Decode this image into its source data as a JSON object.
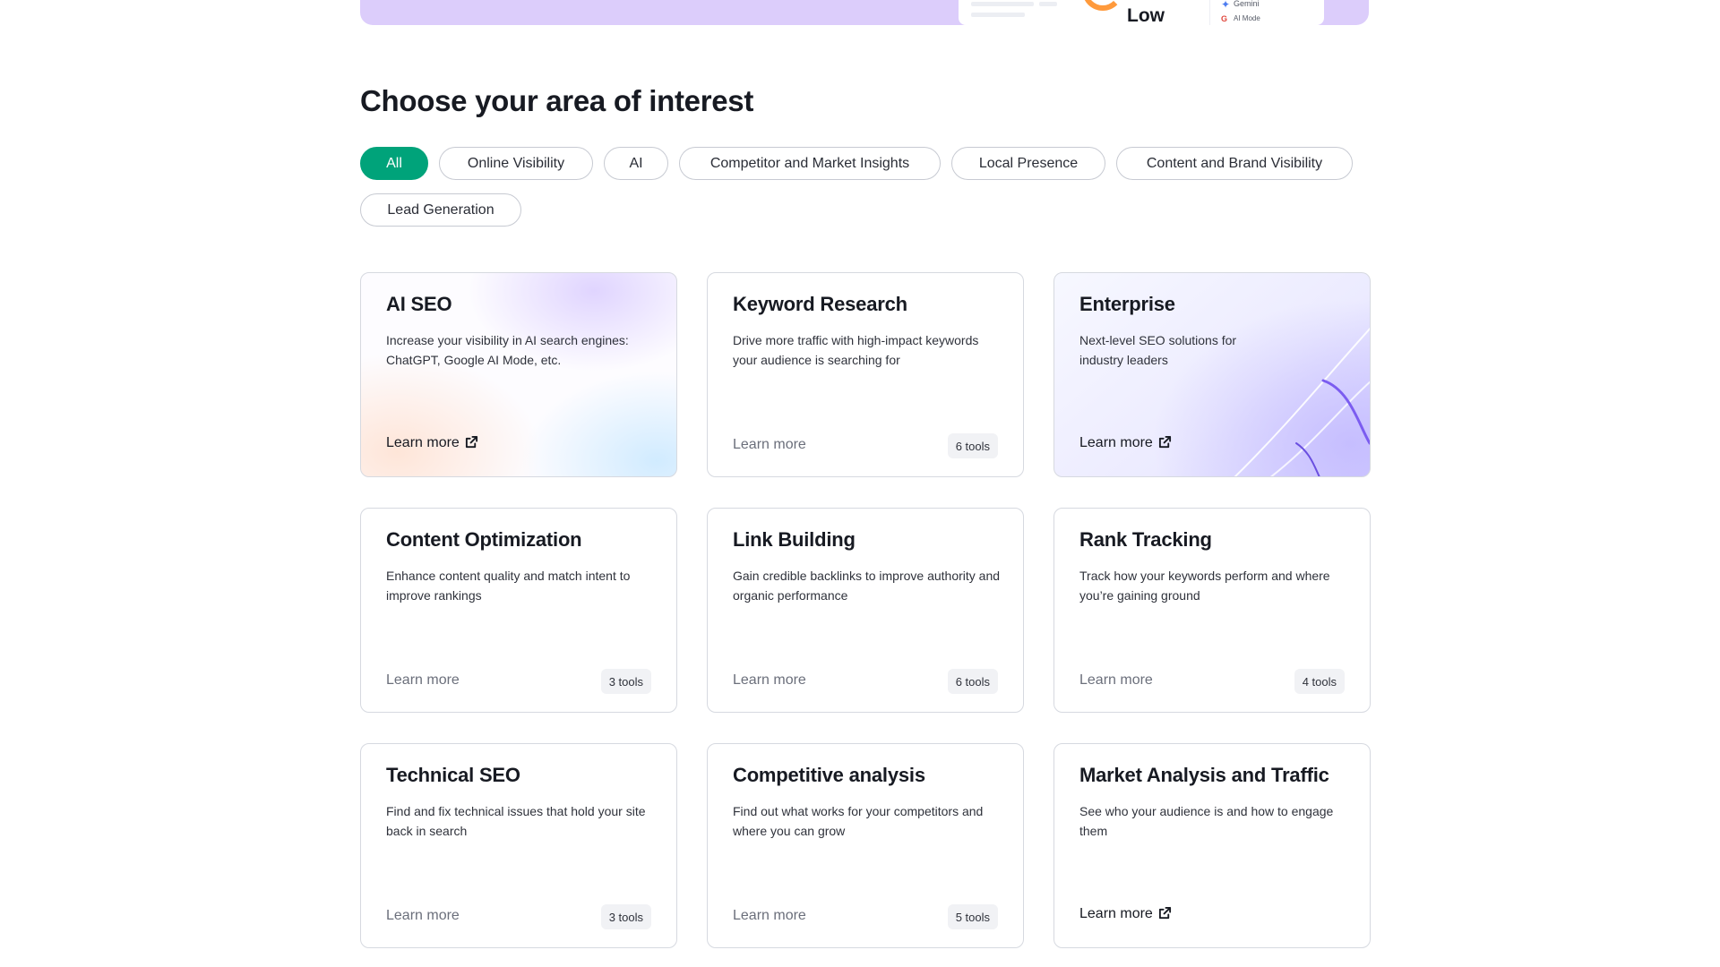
{
  "banner": {
    "gauge_label": "Low",
    "legend_gemini": "Gemini",
    "legend_ai_mode": "AI Mode"
  },
  "heading": "Choose your area of interest",
  "filters": [
    {
      "label": "All",
      "active": true
    },
    {
      "label": "Online Visibility",
      "active": false
    },
    {
      "label": "AI",
      "active": false
    },
    {
      "label": "Competitor and Market Insights",
      "active": false
    },
    {
      "label": "Local Presence",
      "active": false
    },
    {
      "label": "Content and Brand Visibility",
      "active": false
    },
    {
      "label": "Lead Generation",
      "active": false
    }
  ],
  "cards": [
    {
      "title": "AI SEO",
      "description": "Increase your visibility in AI search engines: ChatGPT, Google AI Mode, etc.",
      "link": "Learn more",
      "external": true,
      "tools": ""
    },
    {
      "title": "Keyword Research",
      "description": "Drive more traffic with high-impact keywords your audience is searching for",
      "link": "Learn more",
      "external": false,
      "tools": "6 tools"
    },
    {
      "title": "Enterprise",
      "description": "Next-level SEO solutions for industry leaders",
      "link": "Learn more",
      "external": true,
      "tools": ""
    },
    {
      "title": "Content Optimization",
      "description": "Enhance content quality and match intent to improve rankings",
      "link": "Learn more",
      "external": false,
      "tools": "3 tools"
    },
    {
      "title": "Link Building",
      "description": "Gain credible backlinks to improve authority and organic performance",
      "link": "Learn more",
      "external": false,
      "tools": "6 tools"
    },
    {
      "title": "Rank Tracking",
      "description": "Track how your keywords perform and where you’re gaining ground",
      "link": "Learn more",
      "external": false,
      "tools": "4 tools"
    },
    {
      "title": "Technical SEO",
      "description": "Find and fix technical issues that hold your site back in search",
      "link": "Learn more",
      "external": false,
      "tools": "3 tools"
    },
    {
      "title": "Competitive analysis",
      "description": "Find out what works for your competitors and where you can grow",
      "link": "Learn more",
      "external": false,
      "tools": "5 tools"
    },
    {
      "title": "Market Analysis and Traffic",
      "description": "See who your audience is and how to engage them",
      "link": "Learn more",
      "external": true,
      "tools": ""
    }
  ],
  "colors": {
    "accent": "#00a37a",
    "banner": "#dccdfb"
  },
  "icons": {
    "external_link": "external-link-icon",
    "gemini": "gemini-star-icon"
  }
}
